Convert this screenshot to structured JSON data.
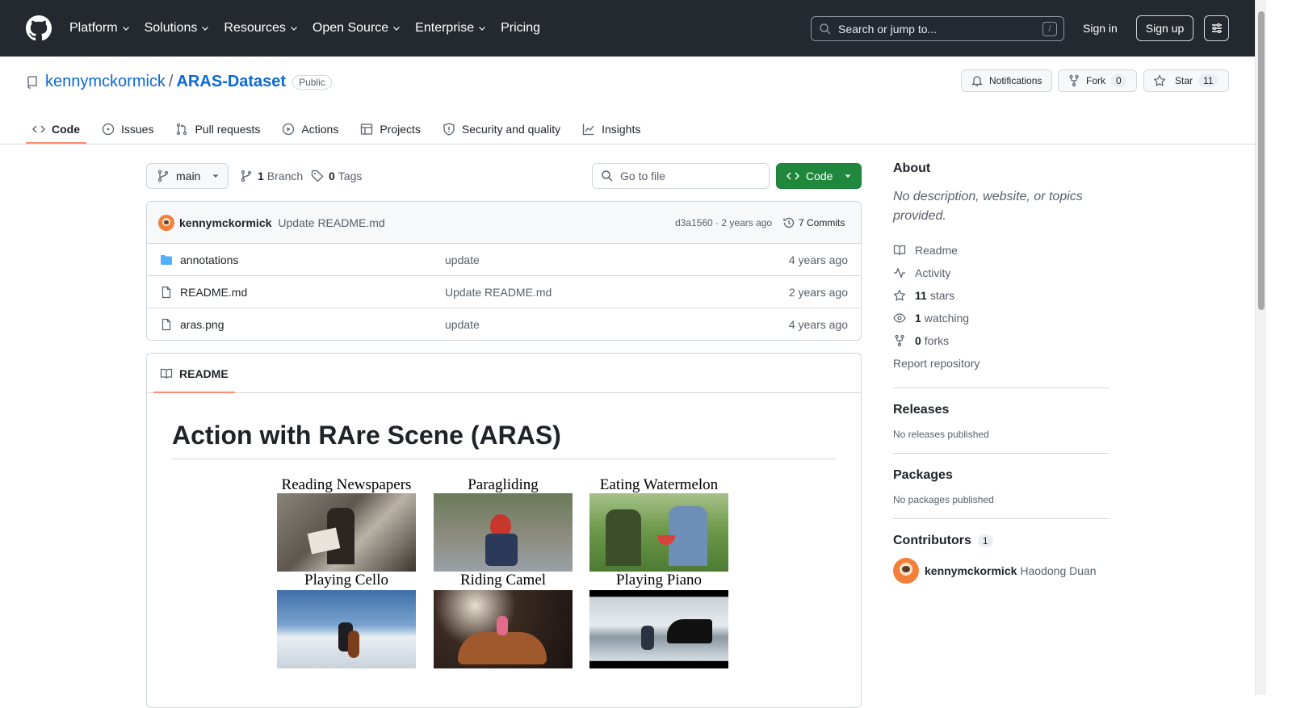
{
  "topbar": {
    "nav": [
      "Platform",
      "Solutions",
      "Resources",
      "Open Source",
      "Enterprise",
      "Pricing"
    ],
    "search_placeholder": "Search or jump to...",
    "slash": "/",
    "signin": "Sign in",
    "signup": "Sign up"
  },
  "repo": {
    "owner": "kennymckormick",
    "sep": "/",
    "name": "ARAS-Dataset",
    "visibility": "Public",
    "notifications": "Notifications",
    "fork": "Fork",
    "fork_count": "0",
    "star": "Star",
    "star_count": "11"
  },
  "tabs": [
    "Code",
    "Issues",
    "Pull requests",
    "Actions",
    "Projects",
    "Security and quality",
    "Insights"
  ],
  "toolbar": {
    "branch": "main",
    "branch_count": "1",
    "branch_label": "Branch",
    "tag_count": "0",
    "tag_label": "Tags",
    "goto_placeholder": "Go to file",
    "code_button": "Code"
  },
  "commit": {
    "author": "kennymckormick",
    "message": "Update README.md",
    "meta": "d3a1560 · 2 years ago",
    "commits": "7 Commits"
  },
  "files": [
    {
      "name": "annotations",
      "type": "folder",
      "message": "update",
      "age": "4 years ago"
    },
    {
      "name": "README.md",
      "type": "file",
      "message": "Update README.md",
      "age": "2 years ago"
    },
    {
      "name": "aras.png",
      "type": "file",
      "message": "update",
      "age": "4 years ago"
    }
  ],
  "readme": {
    "tab": "README",
    "heading": "Action with RAre Scene (ARAS)",
    "captions": [
      "Reading Newspapers",
      "Paragliding",
      "Eating Watermelon",
      "Playing Cello",
      "Riding Camel",
      "Playing Piano"
    ]
  },
  "about": {
    "title": "About",
    "description": "No description, website, or topics provided.",
    "readme": "Readme",
    "activity": "Activity",
    "stars_count": "11",
    "stars_label": "stars",
    "watching_count": "1",
    "watching_label": "watching",
    "forks_count": "0",
    "forks_label": "forks",
    "report": "Report repository"
  },
  "releases": {
    "title": "Releases",
    "text": "No releases published"
  },
  "packages": {
    "title": "Packages",
    "text": "No packages published"
  },
  "contributors": {
    "title": "Contributors",
    "count": "1",
    "user": "kennymckormick",
    "fullname": "Haodong Duan"
  },
  "colors": {
    "accent": "#0969da",
    "green": "#1f883d",
    "tab_underline": "#fd8c73",
    "header": "#24292f"
  }
}
